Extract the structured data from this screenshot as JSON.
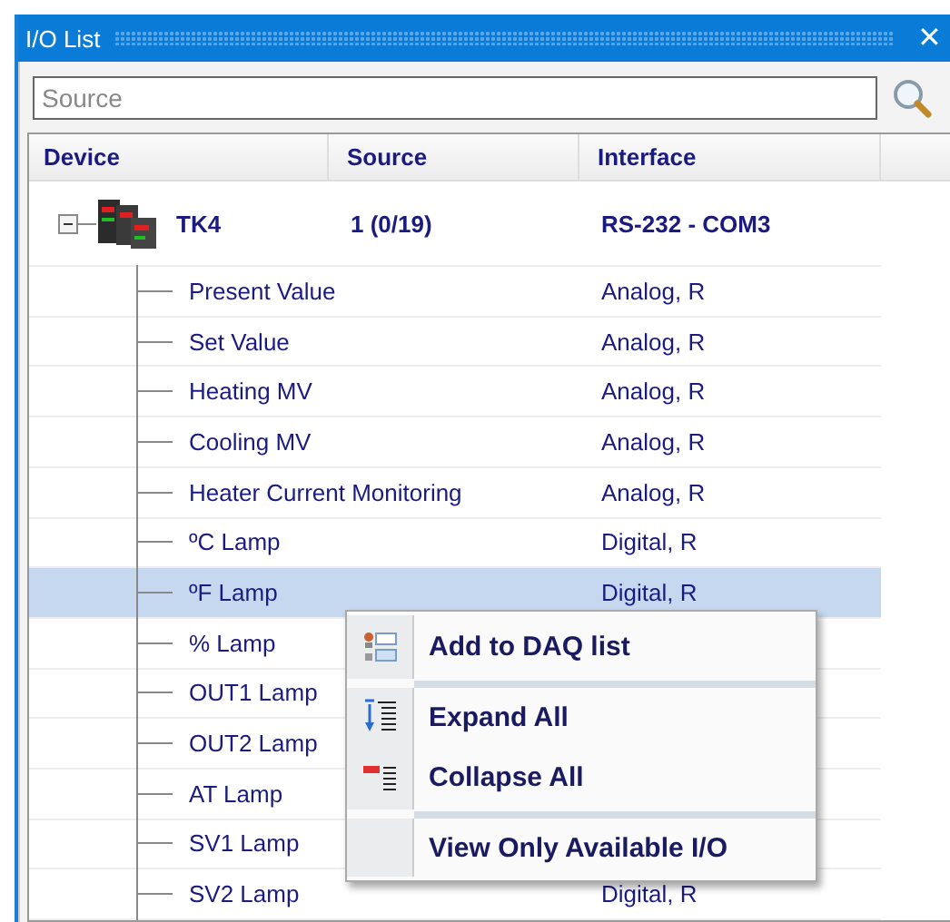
{
  "window": {
    "title": "I/O List",
    "close": "✕"
  },
  "search": {
    "placeholder": "Source"
  },
  "table": {
    "columns": [
      "Device",
      "Source",
      "Interface"
    ],
    "device": {
      "name": "TK4",
      "source": "1 (0/19)",
      "interface": "RS-232 - COM3",
      "expanded": true,
      "children": [
        {
          "name": "Present Value",
          "interface": "Analog, R",
          "selected": false
        },
        {
          "name": "Set Value",
          "interface": "Analog, R",
          "selected": false
        },
        {
          "name": "Heating MV",
          "interface": "Analog, R",
          "selected": false
        },
        {
          "name": "Cooling MV",
          "interface": "Analog, R",
          "selected": false
        },
        {
          "name": "Heater Current Monitoring",
          "interface": "Analog, R",
          "selected": false
        },
        {
          "name": "ºC Lamp",
          "interface": "Digital, R",
          "selected": false
        },
        {
          "name": "ºF Lamp",
          "interface": "Digital, R",
          "selected": true
        },
        {
          "name": "% Lamp",
          "selected": false
        },
        {
          "name": "OUT1 Lamp",
          "selected": false
        },
        {
          "name": "OUT2 Lamp",
          "selected": false
        },
        {
          "name": "AT Lamp",
          "selected": false
        },
        {
          "name": "SV1 Lamp",
          "selected": false
        },
        {
          "name": "SV2 Lamp",
          "interface": "Digital, R",
          "selected": false
        }
      ]
    }
  },
  "context_menu": {
    "items": [
      {
        "label": "Add to DAQ list",
        "kind": "add",
        "separator_after": true
      },
      {
        "label": "Expand All",
        "kind": "expand",
        "separator_after": false
      },
      {
        "label": "Collapse All",
        "kind": "collapse",
        "separator_after": true
      },
      {
        "label": "View Only Available I/O",
        "kind": "plain",
        "separator_after": false
      }
    ]
  }
}
